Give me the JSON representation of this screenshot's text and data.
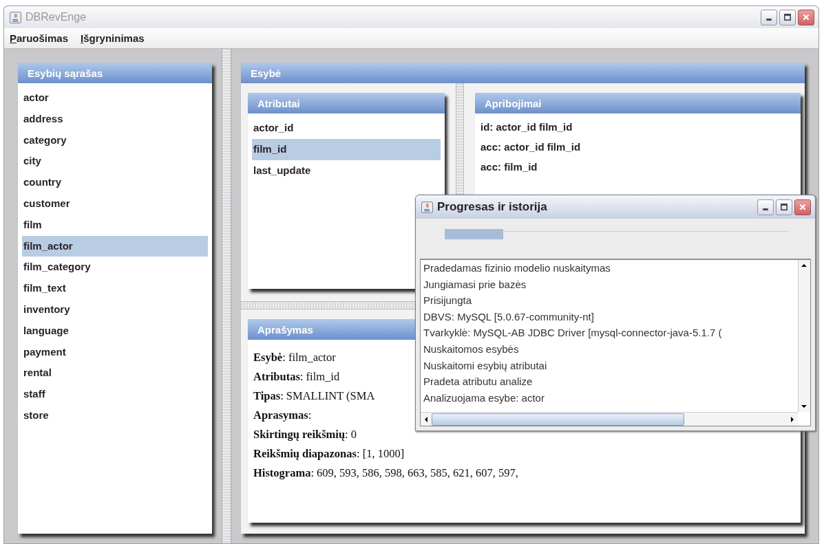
{
  "window": {
    "title": "DBRevEnge",
    "active": false
  },
  "menu": [
    {
      "label": "Paruošimas"
    },
    {
      "label": "Išgryninimas"
    }
  ],
  "entity_list": {
    "title": "Esybių sąrašas",
    "items": [
      {
        "label": "actor",
        "selected": false
      },
      {
        "label": "address",
        "selected": false
      },
      {
        "label": "category",
        "selected": false
      },
      {
        "label": "city",
        "selected": false
      },
      {
        "label": "country",
        "selected": false
      },
      {
        "label": "customer",
        "selected": false
      },
      {
        "label": "film",
        "selected": false
      },
      {
        "label": "film_actor",
        "selected": true
      },
      {
        "label": "film_category",
        "selected": false
      },
      {
        "label": "film_text",
        "selected": false
      },
      {
        "label": "inventory",
        "selected": false
      },
      {
        "label": "language",
        "selected": false
      },
      {
        "label": "payment",
        "selected": false
      },
      {
        "label": "rental",
        "selected": false
      },
      {
        "label": "staff",
        "selected": false
      },
      {
        "label": "store",
        "selected": false
      }
    ]
  },
  "entity_panel": {
    "title": "Esybė",
    "attributes": {
      "title": "Atributai",
      "items": [
        {
          "label": "actor_id",
          "selected": false
        },
        {
          "label": "film_id",
          "selected": true
        },
        {
          "label": "last_update",
          "selected": false
        }
      ]
    },
    "constraints": {
      "title": "Apribojimai",
      "items": [
        "id: actor_id film_id",
        "acc: actor_id film_id",
        "acc: film_id"
      ]
    },
    "description": {
      "title": "Aprašymas",
      "lines": [
        "**Esybė**: film_actor",
        "**Atributas**: film_id",
        "**Tipas**: SMALLINT (SMA",
        "**Aprasymas**:",
        "**Skirtingų reikšmių**: 0",
        "**Reikšmių diapazonas**: [1, 1000]",
        "**Histograma**: 609, 593, 586, 598, 663, 585, 621, 607, 597,"
      ]
    }
  },
  "progress_dialog": {
    "title": "Progresas ir istorija",
    "active": true,
    "progress": {
      "level": 0.17
    },
    "log": [
      "Pradedamas fizinio modelio nuskaitymas",
      "Jungiamasi prie bazės",
      "Prisijungta",
      "DBVS: MySQL [5.0.67-community-nt]",
      "Tvarkyklė: MySQL-AB JDBC Driver [mysql-connector-java-5.1.7 (",
      "Nuskaitomos esybės",
      "Nuskaitomi esybių atributai",
      "Pradeta atributu analize",
      "Analizuojama esybe: actor"
    ]
  }
}
